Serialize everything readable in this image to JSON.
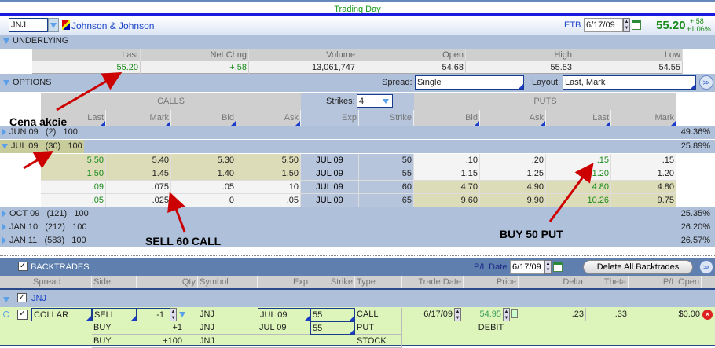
{
  "title": "Trading Day",
  "symbol": {
    "ticker": "JNJ",
    "name": "Johnson & Johnson",
    "etb": "ETB",
    "date": "6/17/09",
    "price": "55.20",
    "change": "+.58",
    "change_pct": "+1.06%"
  },
  "underlying": {
    "label": "UNDERLYING",
    "headers": [
      "Last",
      "Net Chng",
      "Volume",
      "Open",
      "High",
      "Low"
    ],
    "values": [
      "55.20",
      "+.58",
      "13,061,747",
      "54.68",
      "55.53",
      "54.55"
    ]
  },
  "options": {
    "label": "OPTIONS",
    "spread_label": "Spread:",
    "spread_value": "Single",
    "layout_label": "Layout:",
    "layout_value": "Last, Mark",
    "calls_label": "CALLS",
    "puts_label": "PUTS",
    "strikes_label": "Strikes:",
    "strikes_value": "4",
    "columns": [
      "Last",
      "Mark",
      "Bid",
      "Ask",
      "Exp",
      "Strike",
      "Bid",
      "Ask",
      "Last",
      "Mark"
    ],
    "expirations": [
      {
        "label": "JUN 09",
        "days": "(2)",
        "mult": "100",
        "iv": "49.36%"
      },
      {
        "label": "JUL 09",
        "days": "(30)",
        "mult": "100",
        "iv": "25.89%"
      },
      {
        "label": "OCT 09",
        "days": "(121)",
        "mult": "100",
        "iv": "25.35%"
      },
      {
        "label": "JAN 10",
        "days": "(212)",
        "mult": "100",
        "iv": "26.20%"
      },
      {
        "label": "JAN 11",
        "days": "(583)",
        "mult": "100",
        "iv": "26.57%"
      }
    ],
    "rows": [
      [
        "5.50",
        "5.40",
        "5.30",
        "5.50",
        "JUL 09",
        "50",
        ".10",
        ".20",
        ".15",
        ".15"
      ],
      [
        "1.50",
        "1.45",
        "1.40",
        "1.50",
        "JUL 09",
        "55",
        "1.15",
        "1.25",
        "1.20",
        "1.20"
      ],
      [
        ".09",
        ".075",
        ".05",
        ".10",
        "JUL 09",
        "60",
        "4.70",
        "4.90",
        "4.80",
        "4.80"
      ],
      [
        ".05",
        ".025",
        "0",
        ".05",
        "JUL 09",
        "65",
        "9.60",
        "9.90",
        "10.26",
        "9.75"
      ]
    ]
  },
  "annotations": {
    "price": "Cena akcie",
    "sell": "SELL 60 CALL",
    "buy": "BUY 50 PUT"
  },
  "backtrades": {
    "label": "BACKTRADES",
    "pl_date_label": "P/L Date",
    "pl_date": "6/17/09",
    "delete_label": "Delete All Backtrades",
    "columns": [
      "Spread",
      "Side",
      "Qty",
      "Symbol",
      "Exp",
      "Strike",
      "Type",
      "Trade Date",
      "Price",
      "Delta",
      "Theta",
      "P/L Open"
    ],
    "group": "JNJ",
    "trade": {
      "spread": "COLLAR",
      "trade_date": "6/17/09",
      "price": "54.95",
      "price_type": "DEBIT",
      "delta": ".23",
      "theta": ".33",
      "pl_open": "$0.00",
      "legs": [
        {
          "side": "SELL",
          "qty": "-1",
          "symbol": "JNJ",
          "exp": "JUL 09",
          "strike": "55",
          "type": "CALL"
        },
        {
          "side": "BUY",
          "qty": "+1",
          "symbol": "JNJ",
          "exp": "JUL 09",
          "strike": "55",
          "type": "PUT"
        },
        {
          "side": "BUY",
          "qty": "+100",
          "symbol": "JNJ",
          "exp": "",
          "strike": "",
          "type": "STOCK"
        }
      ]
    }
  }
}
